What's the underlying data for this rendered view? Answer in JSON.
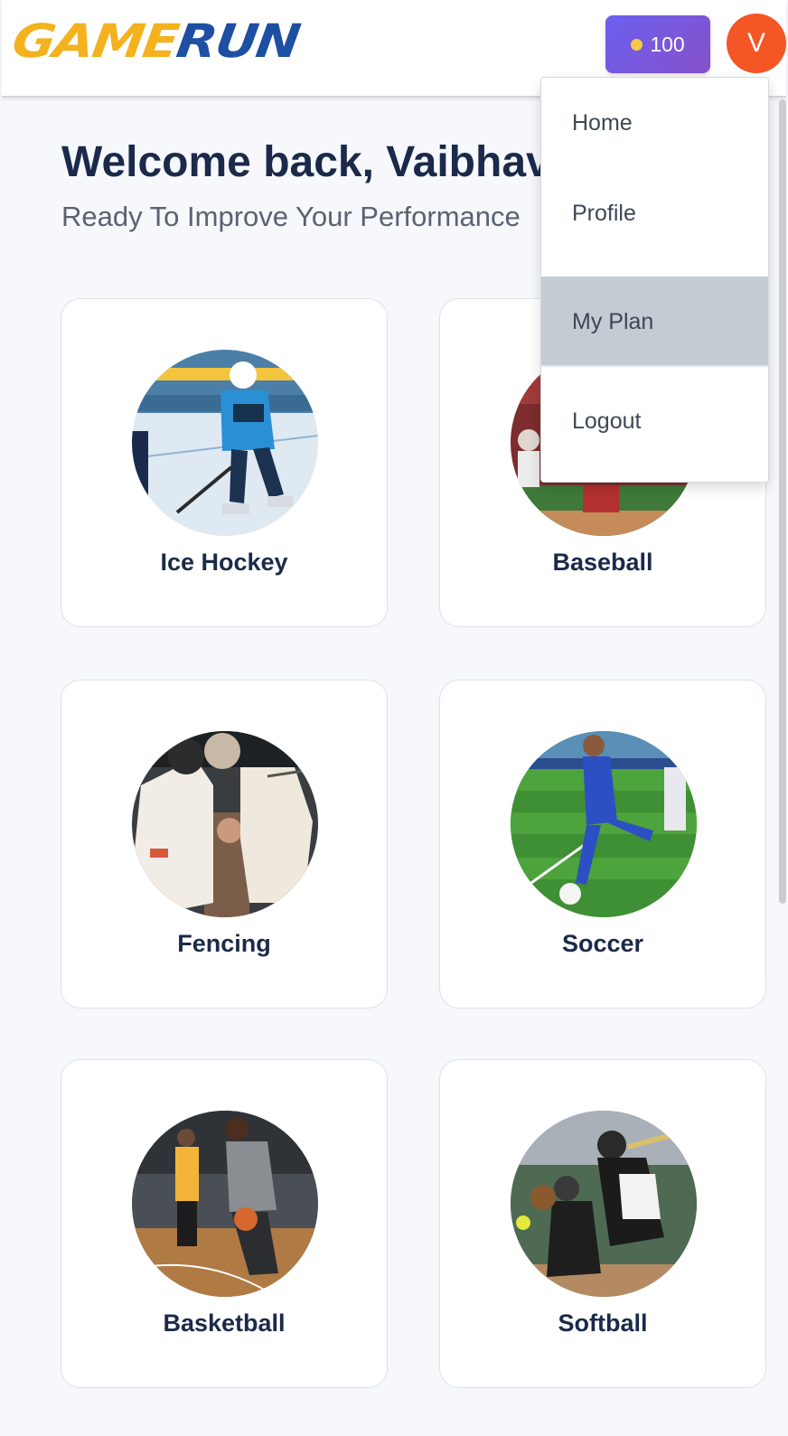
{
  "header": {
    "logo_game": "GAME",
    "logo_run": "RUN",
    "coins": "100",
    "avatar_initial": "V"
  },
  "greeting": {
    "welcome": "Welcome back, Vaibhav",
    "subtitle": "Ready To Improve Your Performance"
  },
  "sports": [
    {
      "label": "Ice Hockey",
      "image": "ice-hockey-player-photo"
    },
    {
      "label": "Baseball",
      "image": "baseball-player-photo"
    },
    {
      "label": "Fencing",
      "image": "fencing-match-photo"
    },
    {
      "label": "Soccer",
      "image": "soccer-player-photo"
    },
    {
      "label": "Basketball",
      "image": "basketball-player-photo"
    },
    {
      "label": "Softball",
      "image": "softball-player-photo"
    }
  ],
  "menu": {
    "items": [
      {
        "label": "Home"
      },
      {
        "label": "Profile"
      },
      {
        "label": "My Plan"
      },
      {
        "label": "Logout"
      }
    ],
    "active": "My Plan"
  },
  "colors": {
    "coin_badge": "#6c5ff0",
    "avatar": "#f45626",
    "logo_game": "#f3b21e",
    "logo_run": "#1d4fa3",
    "menu_active": "#c5cbd3"
  }
}
